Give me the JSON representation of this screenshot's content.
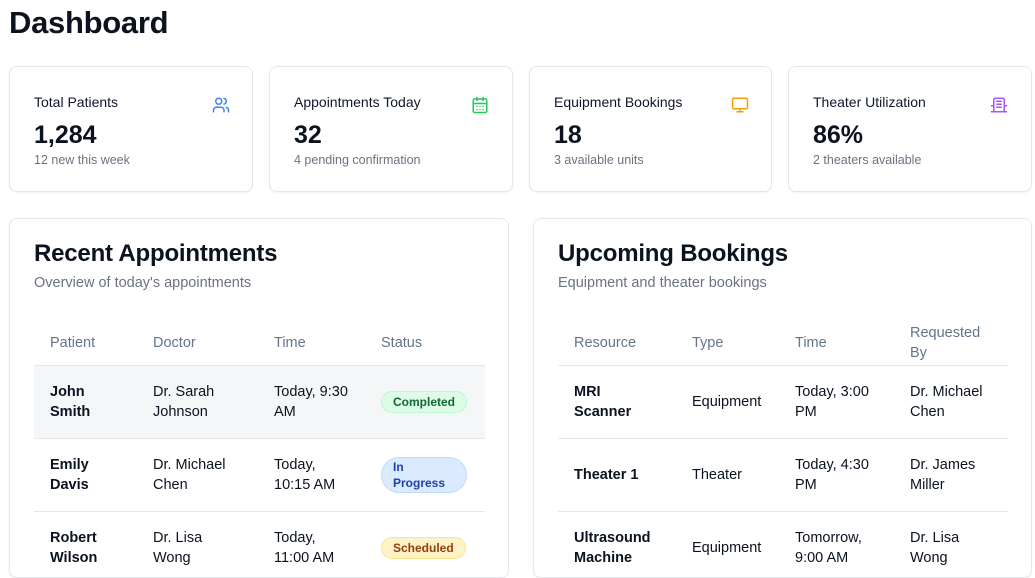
{
  "page": {
    "title": "Dashboard"
  },
  "stats": [
    {
      "label": "Total Patients",
      "value": "1,284",
      "sub": "12 new this week",
      "icon": "users-icon",
      "color": "#3b82f6"
    },
    {
      "label": "Appointments Today",
      "value": "32",
      "sub": "4 pending confirmation",
      "icon": "calendar-icon",
      "color": "#22c55e"
    },
    {
      "label": "Equipment Bookings",
      "value": "18",
      "sub": "3 available units",
      "icon": "monitor-icon",
      "color": "#f59e0b"
    },
    {
      "label": "Theater Utilization",
      "value": "86%",
      "sub": "2 theaters available",
      "icon": "building-icon",
      "color": "#a855f7"
    }
  ],
  "appointments": {
    "title": "Recent Appointments",
    "subtitle": "Overview of today's appointments",
    "columns": [
      "Patient",
      "Doctor",
      "Time",
      "Status"
    ],
    "rows": [
      {
        "patient": "John Smith",
        "doctor": "Dr. Sarah Johnson",
        "time": "Today, 9:30 AM",
        "status": "Completed"
      },
      {
        "patient": "Emily Davis",
        "doctor": "Dr. Michael Chen",
        "time": "Today, 10:15 AM",
        "status": "In Progress"
      },
      {
        "patient": "Robert Wilson",
        "doctor": "Dr. Lisa Wong",
        "time": "Today, 11:00 AM",
        "status": "Scheduled"
      }
    ]
  },
  "bookings": {
    "title": "Upcoming Bookings",
    "subtitle": "Equipment and theater bookings",
    "columns": [
      "Resource",
      "Type",
      "Time",
      "Requested By"
    ],
    "rows": [
      {
        "resource": "MRI Scanner",
        "type": "Equipment",
        "time": "Today, 3:00 PM",
        "requested_by": "Dr. Michael Chen"
      },
      {
        "resource": "Theater 1",
        "type": "Theater",
        "time": "Today, 4:30 PM",
        "requested_by": "Dr. James Miller"
      },
      {
        "resource": "Ultrasound Machine",
        "type": "Equipment",
        "time": "Tomorrow, 9:00 AM",
        "requested_by": "Dr. Lisa Wong"
      }
    ]
  }
}
